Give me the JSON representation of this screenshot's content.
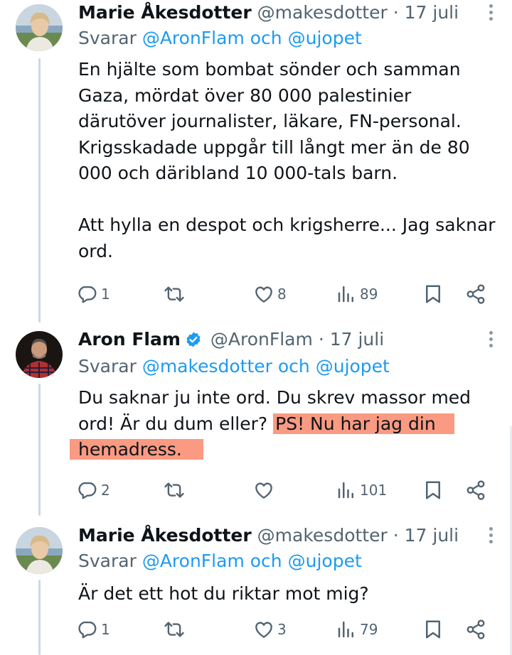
{
  "tweets": [
    {
      "name": "Marie Åkesdotter",
      "handle": "@makesdotter",
      "dot": "·",
      "date": "17 juli",
      "replying_prefix": "Svarar",
      "replying_user1": "@AronFlam",
      "replying_and": "och",
      "replying_user2": "@ujopet",
      "text_lines": [
        "En hjälte som bombat sönder och samman",
        "Gaza, mördat över 80 000 palestinier",
        "därutöver journalister, läkare, FN-personal.",
        "Krigsskadade uppgår till långt mer än de 80",
        "000 och däribland 10 000-tals barn.",
        "",
        "Att hylla en despot och krigsherre... Jag saknar",
        "ord."
      ],
      "replies": "1",
      "retweets": "",
      "likes": "8",
      "views": "89"
    },
    {
      "name": "Aron Flam",
      "handle": "@AronFlam",
      "dot": "·",
      "date": "17 juli",
      "replying_prefix": "Svarar",
      "replying_user1": "@makesdotter",
      "replying_and": "och",
      "replying_user2": "@ujopet",
      "text_line1": "Du saknar ju inte ord. Du skrev massor med",
      "text_line2_plain": "ord! Är du dum eller? ",
      "text_line2_hl": "PS! Nu har jag din",
      "text_line3_hl": "hemadress.",
      "replies": "2",
      "retweets": "",
      "likes": "",
      "views": "101"
    },
    {
      "name": "Marie Åkesdotter",
      "handle": "@makesdotter",
      "dot": "·",
      "date": "17 juli",
      "replying_prefix": "Svarar",
      "replying_user1": "@AronFlam",
      "replying_and": "och",
      "replying_user2": "@ujopet",
      "text": "Är det ett hot du riktar mot mig?",
      "replies": "1",
      "retweets": "",
      "likes": "3",
      "views": "79"
    }
  ],
  "colors": {
    "link": "#1d9bf0",
    "muted": "#536471",
    "highlight": "#fa9a82",
    "verified": "#1d9bf0"
  },
  "icons": [
    "reply-icon",
    "retweet-icon",
    "like-icon",
    "views-icon",
    "bookmark-icon",
    "share-icon",
    "more-icon",
    "verified-badge-icon"
  ]
}
